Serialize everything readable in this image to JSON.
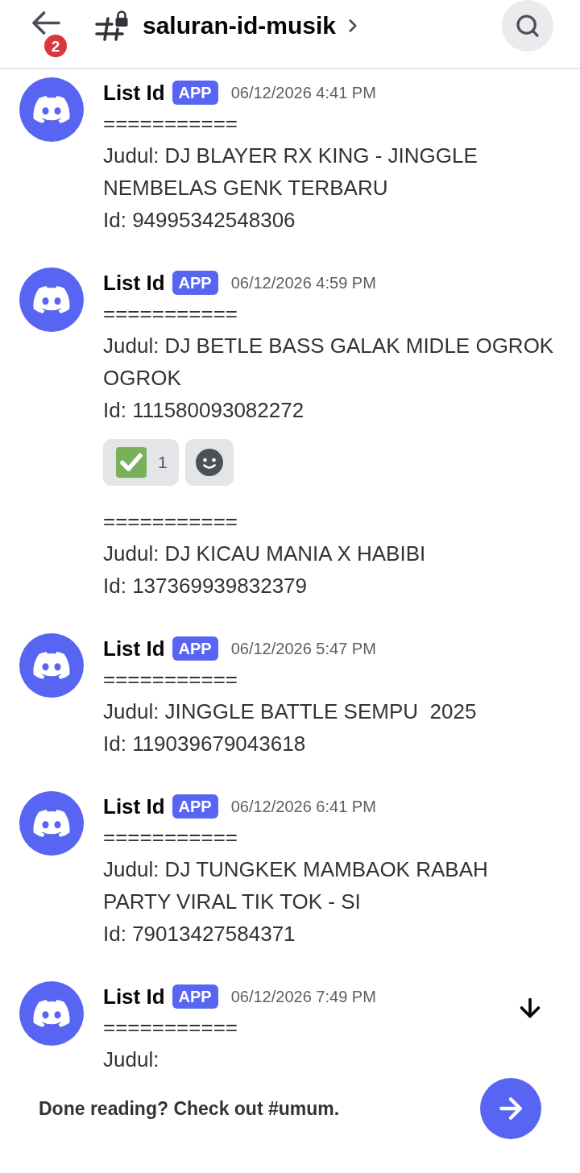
{
  "header": {
    "back_badge": "2",
    "channel_name": "saluran-id-musik"
  },
  "messages": [
    {
      "kind": "group",
      "author": "List Id",
      "tag": "APP",
      "timestamp": "06/12/2026 4:41 PM",
      "lines": [
        "===========",
        "Judul: DJ BLAYER RX KING - JINGGLE NEMBELAS GENK TERBARU",
        "Id: 94995342548306"
      ]
    },
    {
      "kind": "group",
      "author": "List Id",
      "tag": "APP",
      "timestamp": "06/12/2026 4:59 PM",
      "lines": [
        "===========",
        "Judul: DJ BETLE BASS GALAK MIDLE OGROK OGROK",
        "Id: 111580093082272"
      ],
      "reactions": [
        {
          "kind": "emoji",
          "count": "1",
          "selected": false
        },
        {
          "kind": "add"
        }
      ]
    },
    {
      "kind": "continuation",
      "lines": [
        "===========",
        "Judul: DJ KICAU MANIA X HABIBI",
        "Id: 137369939832379"
      ]
    },
    {
      "kind": "group",
      "author": "List Id",
      "tag": "APP",
      "timestamp": "06/12/2026 5:47 PM",
      "lines": [
        "===========",
        "Judul: JINGGLE BATTLE SEMPU  2025",
        "Id: 119039679043618"
      ]
    },
    {
      "kind": "group",
      "author": "List Id",
      "tag": "APP",
      "timestamp": "06/12/2026 6:41 PM",
      "lines": [
        "===========",
        "Judul: DJ TUNGKEK MAMBAOK RABAH PARTY VIRAL TIK TOK - SI",
        "Id: 79013427584371"
      ]
    },
    {
      "kind": "group",
      "author": "List Id",
      "tag": "APP",
      "timestamp": "06/12/2026 7:49 PM",
      "lines": [
        "===========",
        "Judul:"
      ]
    }
  ],
  "footer": {
    "prompt": "Done reading? Check out #umum."
  }
}
